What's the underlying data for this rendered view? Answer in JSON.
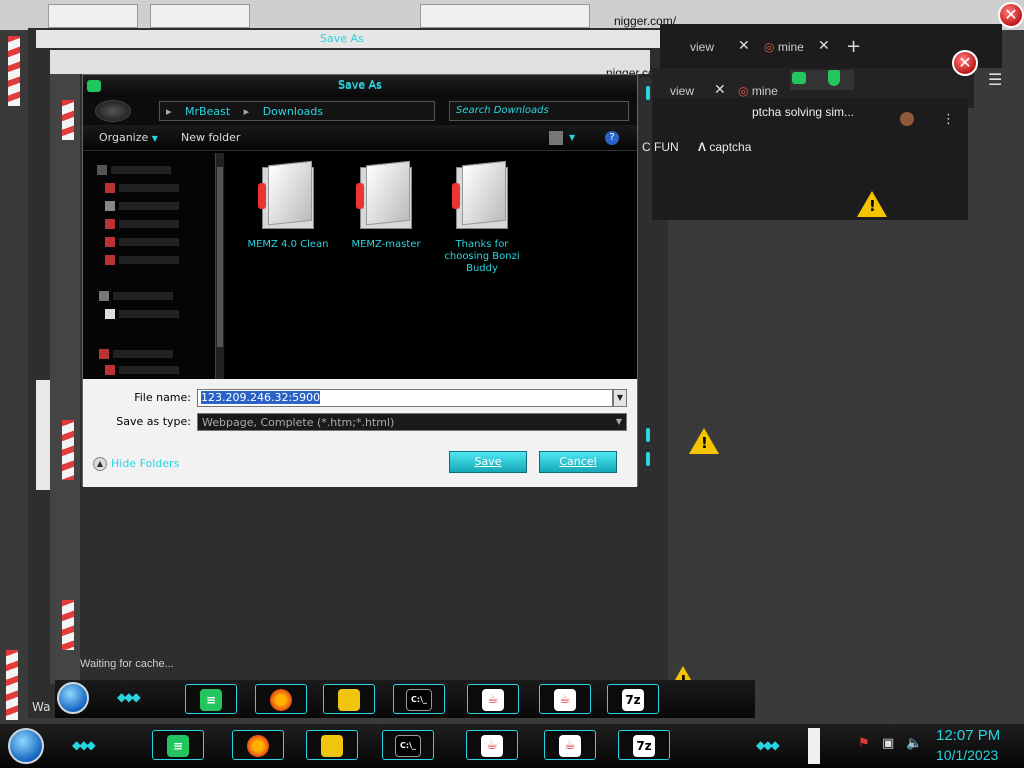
{
  "background": {
    "ghost_url_1": "nigger.com/",
    "ghost_url_2": "nigger.com/",
    "ghost_tab_1": "Save As",
    "ghost_tab_2": "Save As",
    "status_text": "Waiting for cache...",
    "left_stub_text": "Wa"
  },
  "chrome": {
    "tab_view_1": "view",
    "tab_mine_1": "mine",
    "tab_view_2": "view",
    "tab_mine_2": "mine",
    "new_tab": "+",
    "page_title": "ptcha solving sim...",
    "bookmark_1": "C FUN",
    "bookmark_2": "captcha",
    "menu_glyph": "⋮",
    "close_glyph": "✕",
    "tab_close_glyph": "✕"
  },
  "dialog": {
    "title": "Save As",
    "breadcrumb": [
      "MrBeast",
      "Downloads"
    ],
    "search_placeholder": "Search Downloads",
    "organize_label": "Organize",
    "new_folder_label": "New folder",
    "files": [
      {
        "name": "MEMZ 4.0 Clean"
      },
      {
        "name": "MEMZ-master"
      },
      {
        "name": "Thanks for choosing Bonzi Buddy"
      }
    ],
    "file_name_label": "File name:",
    "file_name_value": "123.209.246.32:5900",
    "save_type_label": "Save as type:",
    "save_type_value": "Webpage, Complete (*.htm;*.html)",
    "hide_folders_label": "Hide Folders",
    "save_label": "Save",
    "cancel_label": "Cancel",
    "help_glyph": "?",
    "dropdown_glyph": "▼"
  },
  "taskbar": {
    "time": "12:07 PM",
    "date": "10/1/2023",
    "cmd_label": "C:\\_",
    "sevenzip_label": "7z"
  },
  "colors": {
    "accent": "#2ad4e0",
    "hazard_red": "#e23b3b",
    "warning": "#f5c400"
  }
}
